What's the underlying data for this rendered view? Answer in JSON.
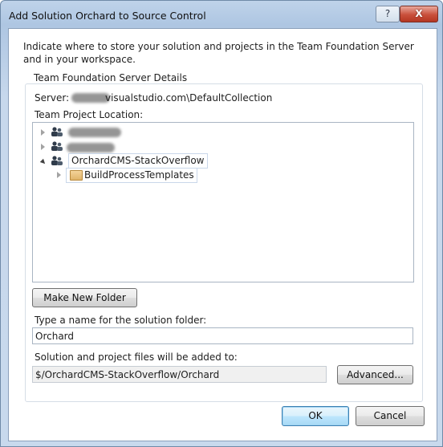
{
  "window": {
    "title": "Add Solution Orchard to Source Control",
    "help_label": "?",
    "close_label": "X"
  },
  "intro": "Indicate where to store your solution and projects in the Team Foundation Server and in your workspace.",
  "group": {
    "legend": "Team Foundation Server Details",
    "server_label": "Server:",
    "server_value": "visualstudio.com\\DefaultCollection",
    "location_label": "Team Project Location:"
  },
  "tree": {
    "team_project": "OrchardCMS-StackOverflow",
    "folder": "BuildProcessTemplates"
  },
  "buttons": {
    "make_new_folder": "Make New Folder",
    "advanced": "Advanced...",
    "ok": "OK",
    "cancel": "Cancel"
  },
  "solution_folder": {
    "label": "Type a name for the solution folder:",
    "value": "Orchard"
  },
  "destination": {
    "label": "Solution and project files will be added to:",
    "value": "$/OrchardCMS-StackOverflow/Orchard"
  }
}
